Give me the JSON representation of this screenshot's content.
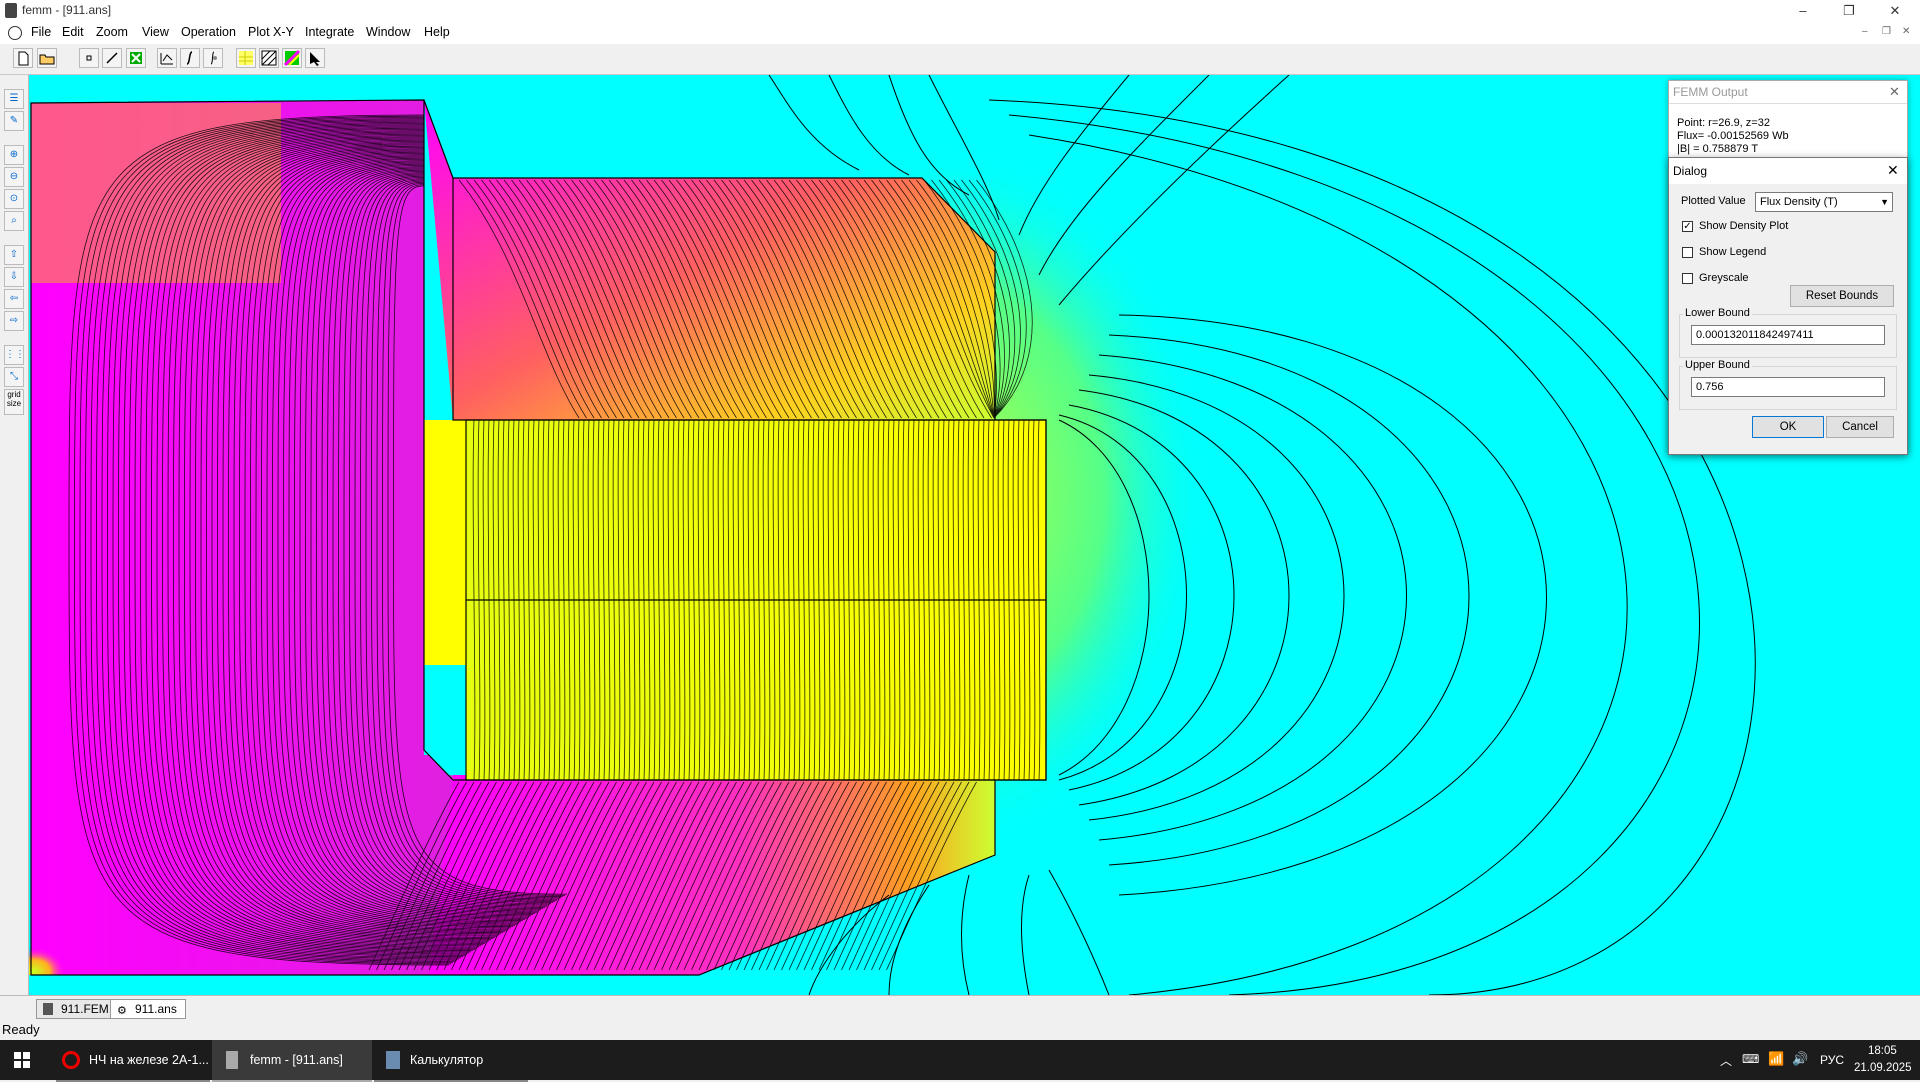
{
  "window": {
    "title": "femm - [911.ans]",
    "minimize": "–",
    "restore": "❐",
    "close": "✕"
  },
  "menu": [
    "File",
    "Edit",
    "Zoom",
    "View",
    "Operation",
    "Plot X-Y",
    "Integrate",
    "Window",
    "Help"
  ],
  "icons": {
    "toolbar": [
      "new-file-icon",
      "open-file-icon",
      "node-mode-icon",
      "segment-mode-icon",
      "block-mode-icon",
      "contour-icon",
      "line-integral-icon",
      "block-integral-icon",
      "density-plot-icon",
      "vector-plot-icon",
      "color-legend-icon",
      "select-arrow-icon"
    ],
    "left": [
      "edit-icon",
      "pencil-icon",
      "zoom-in-icon",
      "zoom-out-icon",
      "zoom-natural-icon",
      "zoom-window-icon",
      "pan-up-icon",
      "pan-down-icon",
      "pan-left-icon",
      "pan-right-icon",
      "grid-icon",
      "snap-icon",
      "grid-size-icon"
    ]
  },
  "left_grid_label": "grid size",
  "colors": {
    "field_background": "#00ffff",
    "high_flux": "#ff00ff",
    "mid_flux": "#ffff00",
    "accent": "#0078d7"
  },
  "femm_output": {
    "title": "FEMM Output",
    "point": "Point: r=26.9, z=32",
    "flux": "Flux= -0.00152569 Wb",
    "b": "|B| = 0.758879 T"
  },
  "dialog": {
    "title": "Dialog",
    "plotted_value_label": "Plotted Value",
    "plotted_value": "Flux Density (T)",
    "show_density": {
      "label": "Show Density Plot",
      "checked": true
    },
    "show_legend": {
      "label": "Show Legend",
      "checked": false
    },
    "greyscale": {
      "label": "Greyscale",
      "checked": false
    },
    "reset_bounds": "Reset Bounds",
    "lower_bound_label": "Lower Bound",
    "lower_bound": "0.000132011842497411",
    "upper_bound_label": "Upper Bound",
    "upper_bound": "0.756",
    "ok": "OK",
    "cancel": "Cancel"
  },
  "tabs": [
    "911.FEM",
    "911.ans"
  ],
  "status": "Ready",
  "taskbar": {
    "items": [
      "НЧ на железе 2А-1...",
      "femm - [911.ans]",
      "Калькулятор"
    ],
    "lang": "РУС",
    "time": "18:05",
    "date": "21.09.2025"
  }
}
